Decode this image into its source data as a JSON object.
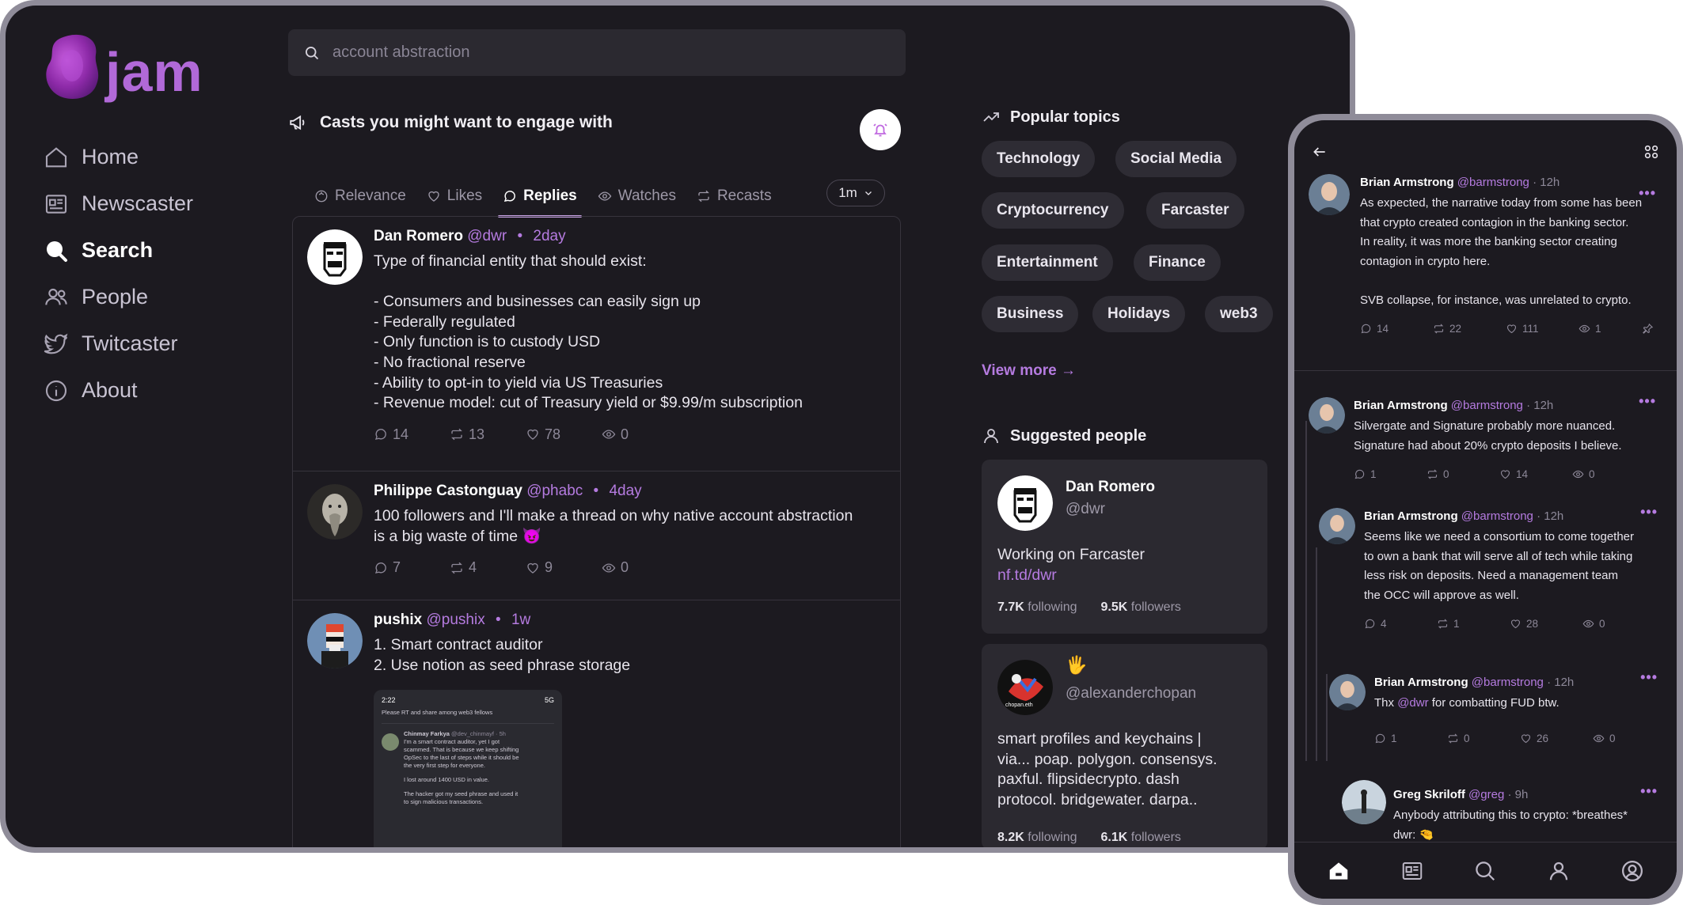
{
  "app": {
    "name": "jam"
  },
  "nav": {
    "items": [
      {
        "label": "Home",
        "icon": "home-icon"
      },
      {
        "label": "Newscaster",
        "icon": "newspaper-icon"
      },
      {
        "label": "Search",
        "icon": "search-icon",
        "active": true
      },
      {
        "label": "People",
        "icon": "people-icon"
      },
      {
        "label": "Twitcaster",
        "icon": "twitter-bird-icon"
      },
      {
        "label": "About",
        "icon": "info-icon"
      }
    ]
  },
  "search": {
    "placeholder": "account abstraction"
  },
  "casts_section": {
    "title": "Casts you might want to engage with"
  },
  "tabs": [
    {
      "label": "Relevance",
      "icon": "sparkle-icon"
    },
    {
      "label": "Likes",
      "icon": "heart-icon"
    },
    {
      "label": "Replies",
      "icon": "reply-icon",
      "active": true
    },
    {
      "label": "Watches",
      "icon": "eye-icon"
    },
    {
      "label": "Recasts",
      "icon": "recast-icon"
    }
  ],
  "range": {
    "selected": "1m"
  },
  "casts": [
    {
      "author": "Dan Romero",
      "handle": "@dwr",
      "time": "2day",
      "lines": [
        "Type of financial entity that should exist:",
        "",
        "- Consumers and businesses can easily sign up",
        "- Federally regulated",
        "- Only function is to custody USD",
        "- No fractional reserve",
        "- Ability to opt-in to yield via US Treasuries",
        "- Revenue model: cut of Treasury yield or $9.99/m subscription"
      ],
      "stats": {
        "replies": "14",
        "recasts": "13",
        "likes": "78",
        "watches": "0"
      }
    },
    {
      "author": "Philippe Castonguay",
      "handle": "@phabc",
      "time": "4day",
      "lines": [
        "100 followers and I'll make a thread on why native account abstraction",
        "is a big waste of time 😈"
      ],
      "stats": {
        "replies": "7",
        "recasts": "4",
        "likes": "9",
        "watches": "0"
      }
    },
    {
      "author": "pushix",
      "handle": "@pushix",
      "time": "1w",
      "lines": [
        "1. Smart contract auditor",
        "2. Use notion as seed phrase storage"
      ],
      "embed": {
        "clock": "2:22",
        "signal": "5G",
        "line_top": "Please RT and share among web3 fellows",
        "reply_author": "Chinmay Farkya",
        "reply_handle": "@dev_chinmayf · 5h",
        "reply_lines": [
          "I'm a smart contract auditor, yet I got",
          "scammed. That is because we keep shifting",
          "OpSec to the last of steps while it should be",
          "the very first step for everyone.",
          "",
          "I lost around 1400 USD in value.",
          "",
          "The hacker got my seed phrase and used it",
          "to sign malicious transactions."
        ]
      }
    }
  ],
  "popular_topics": {
    "title": "Popular topics",
    "chips": [
      "Technology",
      "Social Media",
      "Cryptocurrency",
      "Farcaster",
      "Entertainment",
      "Finance",
      "Business",
      "Holidays",
      "web3"
    ],
    "view_more": "View more →"
  },
  "suggested_people": {
    "title": "Suggested people",
    "people": [
      {
        "name": "Dan Romero",
        "handle": "@dwr",
        "bio": "Working on Farcaster",
        "link": "nf.td/dwr",
        "following": "7.7K",
        "following_label": "following",
        "followers": "9.5K",
        "followers_label": "followers"
      },
      {
        "name": "🖐",
        "handle": "@alexanderchopan",
        "avatar_text": "chopan.eth",
        "bio_lines": [
          "smart profiles and keychains |",
          "via... poap. polygon. consensys.",
          "paxful. flipsidecrypto. dash",
          "protocol. bridgewater. darpa.."
        ],
        "following": "8.2K",
        "following_label": "following",
        "followers": "6.1K",
        "followers_label": "followers"
      }
    ]
  },
  "phone": {
    "posts": [
      {
        "author": "Brian Armstrong",
        "handle": "@barmstrong",
        "time": "· 12h",
        "lines": [
          "As expected, the narrative today from some has been",
          "that crypto created contagion in the banking sector.",
          "In reality, it was more the banking sector creating",
          "contagion in crypto here.",
          "",
          "SVB collapse, for instance, was unrelated to crypto."
        ],
        "stats": {
          "replies": "14",
          "recasts": "22",
          "likes": "111",
          "watches": "1"
        }
      },
      {
        "author": "Brian Armstrong",
        "handle": "@barmstrong",
        "time": "· 12h",
        "lines": [
          "Silvergate and Signature probably more nuanced.",
          "Signature had about 20% crypto deposits I believe."
        ],
        "stats": {
          "replies": "1",
          "recasts": "0",
          "likes": "14",
          "watches": "0"
        }
      },
      {
        "author": "Brian Armstrong",
        "handle": "@barmstrong",
        "time": "· 12h",
        "lines": [
          "Seems like we need a consortium to come together",
          "to own a bank that will serve all of tech while taking",
          "less risk on deposits. Need a management team",
          "the OCC will approve as well."
        ],
        "stats": {
          "replies": "4",
          "recasts": "1",
          "likes": "28",
          "watches": "0"
        }
      },
      {
        "author": "Brian Armstrong",
        "handle": "@barmstrong",
        "time": "· 12h",
        "pre": "Thx ",
        "mention": "@dwr",
        "post": " for combatting FUD btw.",
        "stats": {
          "replies": "1",
          "recasts": "0",
          "likes": "26",
          "watches": "0"
        }
      },
      {
        "author": "Greg Skriloff",
        "handle": "@greg",
        "time": "· 9h",
        "lines": [
          "Anybody attributing this to crypto: *breathes*",
          "dwr: 🤏"
        ]
      }
    ],
    "bottom_nav": [
      "home-icon",
      "newspaper-icon",
      "search-icon",
      "user-icon",
      "account-icon"
    ]
  },
  "colors": {
    "accent": "#b57be0",
    "background": "#1c1a20",
    "card": "#2b2930",
    "frame": "#8f8c99",
    "logo": "#b169d8"
  }
}
